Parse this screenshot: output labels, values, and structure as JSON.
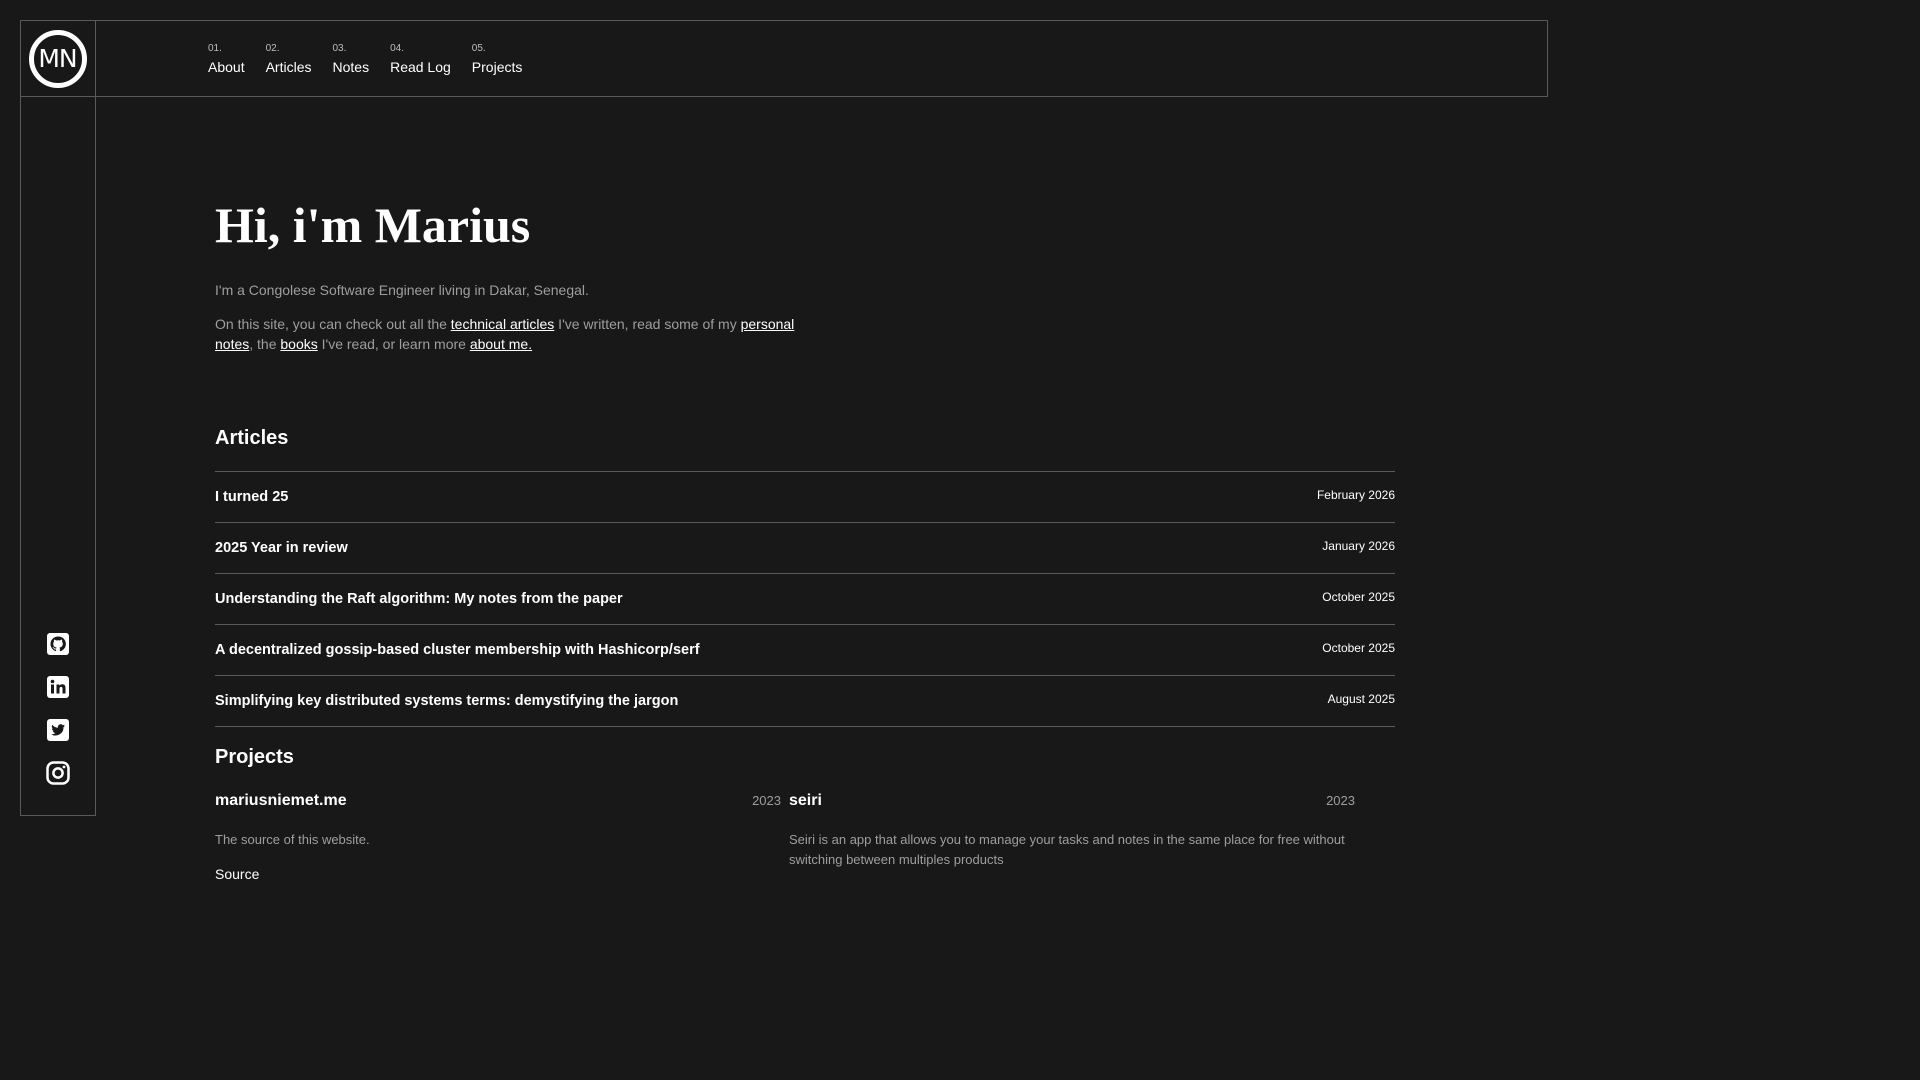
{
  "brand": {
    "logo_text": "MN"
  },
  "nav": [
    {
      "num": "01.",
      "label": "About"
    },
    {
      "num": "02.",
      "label": "Articles"
    },
    {
      "num": "03.",
      "label": "Notes"
    },
    {
      "num": "04.",
      "label": "Read Log"
    },
    {
      "num": "05.",
      "label": "Projects"
    }
  ],
  "hero": {
    "title": "Hi, i'm Marius",
    "line1": "I'm a Congolese Software Engineer living in Dakar, Senegal.",
    "p2_a": "On this site, you can check out all the ",
    "link_articles": "technical articles",
    "p2_b": " I've written, read some of my ",
    "link_notes": "personal notes",
    "p2_c": ", the ",
    "link_books": "books",
    "p2_d": " I've read, or learn more ",
    "link_about": "about me."
  },
  "articles": {
    "heading": "Articles",
    "items": [
      {
        "title": "I turned 25",
        "date": "February 2026"
      },
      {
        "title": "2025 Year in review",
        "date": "January 2026"
      },
      {
        "title": "Understanding the Raft algorithm: My notes from the paper",
        "date": "October 2025"
      },
      {
        "title": "A decentralized gossip-based cluster membership with Hashicorp/serf",
        "date": "October 2025"
      },
      {
        "title": "Simplifying key distributed systems terms: demystifying the jargon",
        "date": "August 2025"
      }
    ]
  },
  "projects": {
    "heading": "Projects",
    "items": [
      {
        "name": "mariusniemet.me",
        "year": "2023",
        "desc": "The source of this website.",
        "link": "Source"
      },
      {
        "name": "seiri",
        "year": "2023",
        "desc": "Seiri is an app that allows you to manage your tasks and notes in the same place for free without switching between multiples products",
        "link": ""
      }
    ]
  },
  "socials": [
    "github-icon",
    "linkedin-icon",
    "twitter-icon",
    "instagram-icon"
  ]
}
